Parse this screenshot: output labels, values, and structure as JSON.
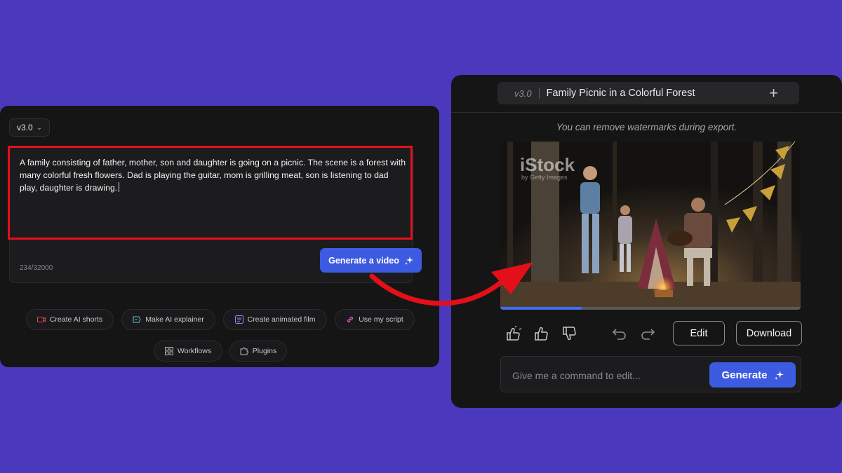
{
  "left": {
    "version": "v3.0",
    "prompt_text": "A family consisting of father, mother, son and daughter is going on a picnic. The scene is a forest with many colorful fresh flowers. Dad is playing the guitar, mom is grilling meat, son is listening to dad play, daughter is drawing.",
    "char_count": "234/32000",
    "generate_video_label": "Generate a video",
    "chips": {
      "shorts": "Create AI shorts",
      "explainer": "Make AI explainer",
      "animated": "Create animated film",
      "script": "Use my script",
      "workflows": "Workflows",
      "plugins": "Plugins"
    },
    "highlight_color": "#e3101a"
  },
  "right": {
    "version": "v3.0",
    "title": "Family Picnic in a Colorful Forest",
    "watermark_note": "You can remove watermarks during export.",
    "video": {
      "watermark_main": "iStock",
      "watermark_sub": "by Getty Images",
      "progress": 0.27
    },
    "edit_label": "Edit",
    "download_label": "Download",
    "command_placeholder": "Give me a command to edit...",
    "generate_label": "Generate"
  },
  "colors": {
    "background": "#4a39bd",
    "panel": "#151516",
    "accent": "#3d5be0",
    "arrow": "#e3101a"
  },
  "icons": [
    "chevron-down-icon",
    "sparkle-icon",
    "video-icon",
    "explainer-icon",
    "list-icon",
    "link-icon",
    "grid-icon",
    "puzzle-icon",
    "plus-icon",
    "thumbs-up-double-icon",
    "thumbs-up-icon",
    "thumbs-down-icon",
    "undo-icon",
    "redo-icon"
  ]
}
